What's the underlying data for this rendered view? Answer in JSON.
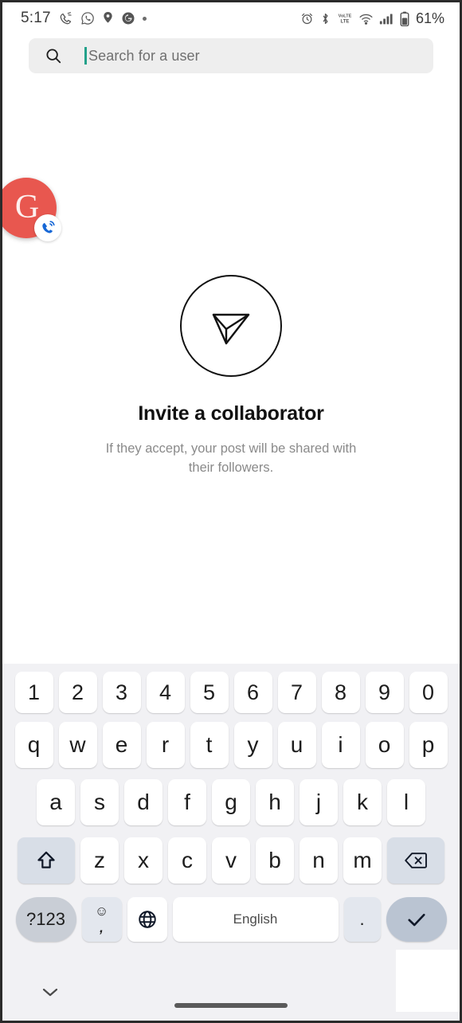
{
  "status_bar": {
    "time": "5:17",
    "left_icons": [
      "phone-call-icon",
      "whatsapp-icon",
      "pin-icon",
      "google-icon",
      "dot-icon"
    ],
    "right_icons": [
      "alarm-icon",
      "bluetooth-icon",
      "volte-icon",
      "wifi-icon",
      "signal-icon",
      "battery-icon"
    ],
    "battery_percent": "61%"
  },
  "search": {
    "icon": "search-icon",
    "placeholder": "Search for a user",
    "value": "",
    "caret_color": "#22a18a",
    "background": "#eeeeee"
  },
  "call_bubble": {
    "letter": "G",
    "background": "#e8574f",
    "badge_icon": "phone-call-icon"
  },
  "empty_state": {
    "icon": "send-paper-plane-icon",
    "title": "Invite a collaborator",
    "subtitle": "If they accept, your post will be shared with their followers."
  },
  "keyboard": {
    "background": "#f1f1f4",
    "number_row": [
      "1",
      "2",
      "3",
      "4",
      "5",
      "6",
      "7",
      "8",
      "9",
      "0"
    ],
    "row1": [
      "q",
      "w",
      "e",
      "r",
      "t",
      "y",
      "u",
      "i",
      "o",
      "p"
    ],
    "row2": [
      "a",
      "s",
      "d",
      "f",
      "g",
      "h",
      "j",
      "k",
      "l"
    ],
    "row3": [
      "z",
      "x",
      "c",
      "v",
      "b",
      "n",
      "m"
    ],
    "shift_icon": "shift-arrow-icon",
    "backspace_icon": "backspace-icon",
    "symbols_label": "?123",
    "emoji_icon": "emoji-smiley-icon",
    "comma_label": ",",
    "globe_icon": "globe-icon",
    "space_label": "English",
    "period_label": ".",
    "enter_icon": "checkmark-icon",
    "fn_key_color": "#d8dee7",
    "enter_key_color": "#bac4d2"
  },
  "nav_bar": {
    "hide_keyboard_icon": "chevron-down-icon",
    "home_indicator": "home-indicator"
  }
}
